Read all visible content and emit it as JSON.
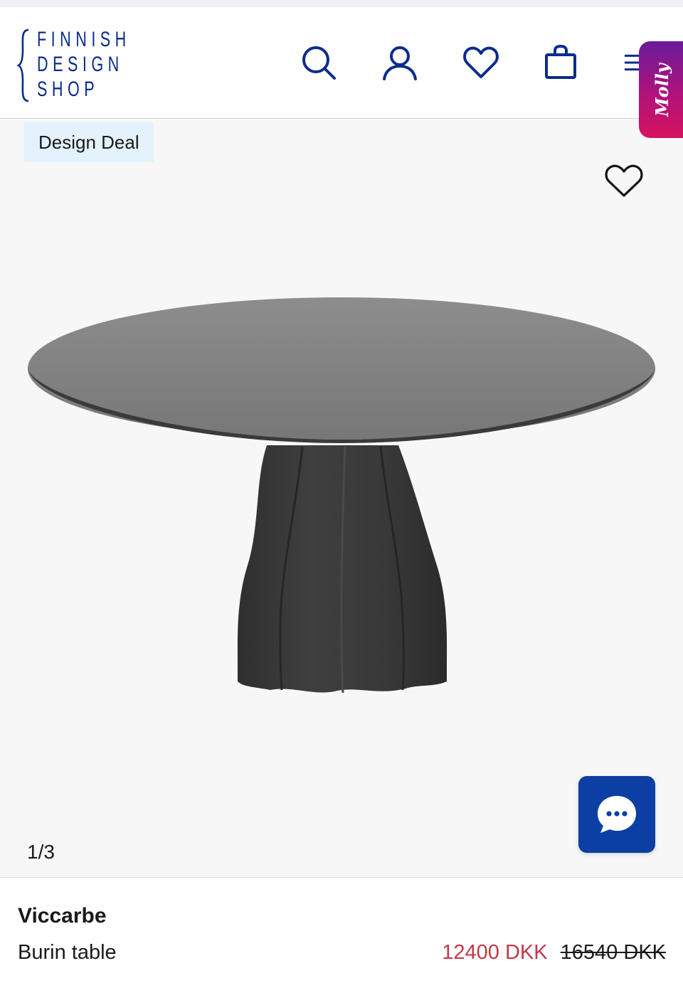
{
  "header": {
    "logo_lines": [
      "FINNISH",
      "DESIGN",
      "SHOP"
    ],
    "icons": [
      "search-icon",
      "account-icon",
      "heart-icon",
      "shopping-bag-icon",
      "menu-icon"
    ],
    "molly_label": "Molly"
  },
  "gallery": {
    "badge": "Design Deal",
    "counter": "1/3",
    "chat_icon": "chat-bubble-icon"
  },
  "product": {
    "brand": "Viccarbe",
    "name": "Burin table",
    "price": "12400 DKK",
    "original_price": "16540 DKK"
  },
  "colors": {
    "brand_blue": "#0b2c8a",
    "chat_blue": "#0b3fa3",
    "sale_red": "#c0394b",
    "badge_bg": "#e3f2fd"
  }
}
